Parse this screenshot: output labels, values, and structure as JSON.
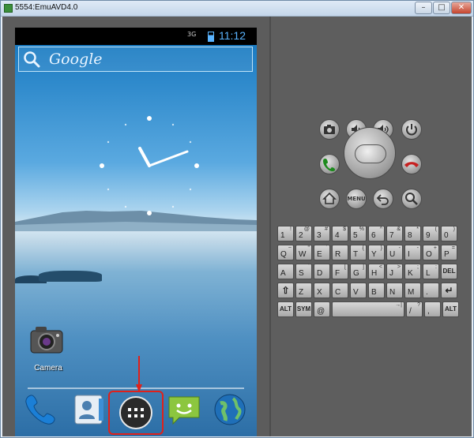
{
  "window": {
    "title": "5554:EmuAVD4.0",
    "min_glyph": "–",
    "max_glyph": "□",
    "close_glyph": "✕"
  },
  "status_bar": {
    "network": "3G",
    "time": "11:12"
  },
  "home": {
    "search_label": "Google",
    "apps": [
      {
        "label": "Camera",
        "icon": "camera-icon"
      }
    ],
    "dock": [
      {
        "icon": "phone-icon"
      },
      {
        "icon": "contacts-icon"
      },
      {
        "icon": "app-launcher-icon"
      },
      {
        "icon": "messaging-icon"
      },
      {
        "icon": "browser-globe-icon"
      }
    ]
  },
  "controls": {
    "top_row": [
      "camera-icon",
      "volume-down-icon",
      "volume-up-icon",
      "power-icon"
    ],
    "call": "call-icon",
    "end_call": "end-call-icon",
    "bottom_row": [
      "home-icon",
      "menu-button",
      "back-icon",
      "search-icon"
    ],
    "menu_label": "MENU"
  },
  "keyboard": {
    "rows": [
      [
        {
          "m": "1",
          "s": "!"
        },
        {
          "m": "2",
          "s": "@"
        },
        {
          "m": "3",
          "s": "#"
        },
        {
          "m": "4",
          "s": "$"
        },
        {
          "m": "5",
          "s": "%"
        },
        {
          "m": "6",
          "s": "^"
        },
        {
          "m": "7",
          "s": "&"
        },
        {
          "m": "8",
          "s": "*"
        },
        {
          "m": "9",
          "s": "("
        },
        {
          "m": "0",
          "s": ")"
        }
      ],
      [
        {
          "m": "Q",
          "s": "~"
        },
        {
          "m": "W",
          "s": "\""
        },
        {
          "m": "E",
          "s": "´"
        },
        {
          "m": "R",
          "s": ""
        },
        {
          "m": "T",
          "s": "{"
        },
        {
          "m": "Y",
          "s": "}"
        },
        {
          "m": "U",
          "s": "-"
        },
        {
          "m": "I",
          "s": "-"
        },
        {
          "m": "O",
          "s": "+"
        },
        {
          "m": "P",
          "s": "="
        }
      ],
      [
        {
          "m": "A",
          "s": ""
        },
        {
          "m": "S",
          "s": "`"
        },
        {
          "m": "D",
          "s": ""
        },
        {
          "m": "F",
          "s": "["
        },
        {
          "m": "G",
          "s": "]"
        },
        {
          "m": "H",
          "s": "<"
        },
        {
          "m": "J",
          "s": ">"
        },
        {
          "m": "K",
          "s": ";"
        },
        {
          "m": "L",
          "s": ":"
        },
        {
          "m": "DEL",
          "s": ""
        }
      ],
      [
        {
          "m": "⇧",
          "s": ""
        },
        {
          "m": "Z",
          "s": ""
        },
        {
          "m": "X",
          "s": ""
        },
        {
          "m": "C",
          "s": ""
        },
        {
          "m": "V",
          "s": ""
        },
        {
          "m": "B",
          "s": ""
        },
        {
          "m": "N",
          "s": ""
        },
        {
          "m": "M",
          "s": ""
        },
        {
          "m": ".",
          "s": ""
        },
        {
          "m": "↵",
          "s": ""
        }
      ],
      [
        {
          "m": "ALT",
          "s": ""
        },
        {
          "m": "SYM",
          "s": ""
        },
        {
          "m": "@",
          "s": ""
        },
        {
          "m": "",
          "s": "→|"
        },
        {
          "m": "/",
          "s": "?"
        },
        {
          "m": ",",
          "s": ""
        },
        {
          "m": "ALT",
          "s": ""
        }
      ]
    ]
  }
}
